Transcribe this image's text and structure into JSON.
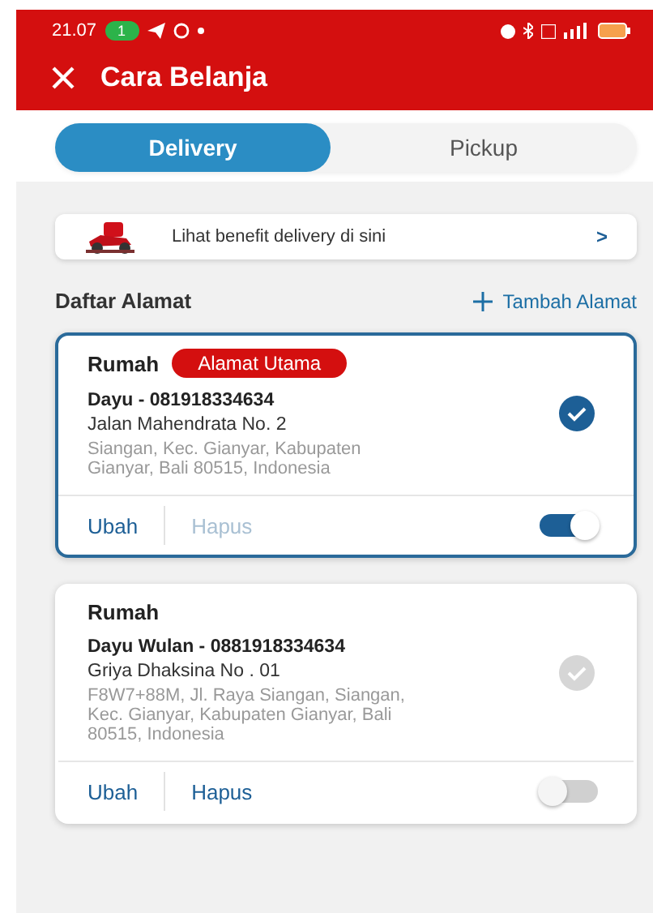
{
  "status_bar": {
    "time": "21.07",
    "badge": "1"
  },
  "header": {
    "title": "Cara Belanja"
  },
  "tabs": [
    {
      "label": "Delivery",
      "selected": true
    },
    {
      "label": "Pickup",
      "selected": false
    }
  ],
  "banner": {
    "text": "Lihat benefit delivery di sini",
    "arrow": ">"
  },
  "section": {
    "title": "Daftar Alamat",
    "action": "Tambah Alamat"
  },
  "addresses": [
    {
      "label": "Rumah",
      "badge": "Alamat Utama",
      "contact": "Dayu - 081918334634",
      "street": "Jalan Mahendrata No. 2",
      "detail": "Siangan, Kec. Gianyar, Kabupaten Gianyar, Bali 80515, Indonesia",
      "selected": true,
      "edit": "Ubah",
      "delete": "Hapus",
      "delete_disabled": true,
      "primary_on": true
    },
    {
      "label": "Rumah",
      "contact": "Dayu Wulan - 0881918334634",
      "street": "Griya Dhaksina No . 01",
      "detail": "F8W7+88M, Jl. Raya Siangan, Siangan, Kec. Gianyar, Kabupaten Gianyar, Bali 80515, Indonesia",
      "selected": false,
      "edit": "Ubah",
      "delete": "Hapus",
      "delete_disabled": false,
      "primary_on": false
    }
  ]
}
